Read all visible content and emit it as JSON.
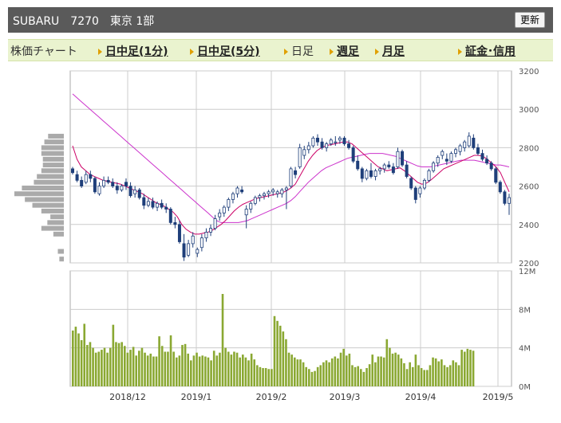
{
  "header": {
    "title": "SUBARU　7270　東京 1部",
    "refresh_label": "更新"
  },
  "tabs": [
    {
      "label": "株価チャート",
      "arrow": false,
      "link": false
    },
    {
      "label": "日中足(1分)",
      "arrow": true,
      "link": true
    },
    {
      "label": "日中足(5分)",
      "arrow": true,
      "link": true
    },
    {
      "label": "日足",
      "arrow": true,
      "link": false
    },
    {
      "label": "週足",
      "arrow": true,
      "link": true
    },
    {
      "label": "月足",
      "arrow": true,
      "link": true
    },
    {
      "label": "証金･信用",
      "arrow": true,
      "link": true
    }
  ],
  "colors": {
    "up_candle": "#ffffff",
    "down_candle": "#1f3f7a",
    "ma_short": "#cc0066",
    "ma_long": "#cc33cc",
    "volume_bar": "#8aa832",
    "grid": "#cccccc"
  },
  "chart_data": [
    {
      "type": "candlestick",
      "y_ticks": [
        2200,
        2400,
        2600,
        2800,
        3000,
        3200
      ],
      "ylim": [
        2200,
        3200
      ],
      "x_tick_labels": [
        "2018/12",
        "2019/1",
        "2019/2",
        "2019/3",
        "2019/4",
        "2019/5"
      ],
      "grid": true,
      "candles": [
        [
          2690,
          2700,
          2660,
          2670
        ],
        [
          2660,
          2680,
          2620,
          2630
        ],
        [
          2630,
          2650,
          2590,
          2600
        ],
        [
          2620,
          2680,
          2610,
          2660
        ],
        [
          2660,
          2680,
          2620,
          2640
        ],
        [
          2640,
          2650,
          2560,
          2570
        ],
        [
          2560,
          2620,
          2550,
          2600
        ],
        [
          2600,
          2650,
          2590,
          2630
        ],
        [
          2630,
          2650,
          2610,
          2620
        ],
        [
          2620,
          2640,
          2590,
          2600
        ],
        [
          2600,
          2620,
          2560,
          2580
        ],
        [
          2580,
          2610,
          2570,
          2600
        ],
        [
          2620,
          2640,
          2580,
          2600
        ],
        [
          2600,
          2620,
          2540,
          2550
        ],
        [
          2560,
          2600,
          2540,
          2580
        ],
        [
          2580,
          2590,
          2530,
          2540
        ],
        [
          2540,
          2560,
          2480,
          2500
        ],
        [
          2500,
          2540,
          2490,
          2520
        ],
        [
          2520,
          2540,
          2480,
          2490
        ],
        [
          2490,
          2520,
          2470,
          2510
        ],
        [
          2510,
          2530,
          2480,
          2490
        ],
        [
          2490,
          2510,
          2460,
          2480
        ],
        [
          2480,
          2490,
          2400,
          2410
        ],
        [
          2410,
          2440,
          2380,
          2400
        ],
        [
          2400,
          2420,
          2300,
          2310
        ],
        [
          2300,
          2350,
          2210,
          2230
        ],
        [
          2240,
          2320,
          2230,
          2300
        ],
        [
          2300,
          2360,
          2280,
          2340
        ],
        [
          2250,
          2280,
          2230,
          2270
        ],
        [
          2280,
          2350,
          2260,
          2330
        ],
        [
          2330,
          2380,
          2310,
          2360
        ],
        [
          2360,
          2400,
          2340,
          2380
        ],
        [
          2380,
          2450,
          2370,
          2430
        ],
        [
          2440,
          2480,
          2420,
          2460
        ],
        [
          2460,
          2500,
          2440,
          2490
        ],
        [
          2490,
          2540,
          2470,
          2530
        ],
        [
          2530,
          2570,
          2510,
          2560
        ],
        [
          2560,
          2600,
          2540,
          2590
        ],
        [
          2580,
          2600,
          2560,
          2570
        ],
        [
          2450,
          2500,
          2380,
          2480
        ],
        [
          2480,
          2520,
          2460,
          2510
        ],
        [
          2510,
          2550,
          2500,
          2540
        ],
        [
          2540,
          2560,
          2520,
          2550
        ],
        [
          2550,
          2570,
          2530,
          2560
        ],
        [
          2560,
          2580,
          2540,
          2570
        ],
        [
          2570,
          2590,
          2550,
          2580
        ],
        [
          2560,
          2580,
          2540,
          2570
        ],
        [
          2560,
          2590,
          2540,
          2580
        ],
        [
          2580,
          2600,
          2480,
          2590
        ],
        [
          2600,
          2700,
          2590,
          2690
        ],
        [
          2680,
          2700,
          2640,
          2660
        ],
        [
          2700,
          2820,
          2690,
          2800
        ],
        [
          2760,
          2810,
          2740,
          2790
        ],
        [
          2790,
          2830,
          2770,
          2810
        ],
        [
          2810,
          2860,
          2800,
          2850
        ],
        [
          2850,
          2870,
          2810,
          2830
        ],
        [
          2830,
          2850,
          2790,
          2800
        ],
        [
          2800,
          2830,
          2780,
          2820
        ],
        [
          2820,
          2850,
          2810,
          2840
        ],
        [
          2830,
          2860,
          2810,
          2830
        ],
        [
          2840,
          2860,
          2820,
          2850
        ],
        [
          2850,
          2860,
          2810,
          2820
        ],
        [
          2820,
          2840,
          2790,
          2800
        ],
        [
          2800,
          2810,
          2720,
          2730
        ],
        [
          2730,
          2760,
          2680,
          2690
        ],
        [
          2690,
          2700,
          2620,
          2640
        ],
        [
          2640,
          2690,
          2630,
          2680
        ],
        [
          2680,
          2720,
          2640,
          2650
        ],
        [
          2650,
          2690,
          2630,
          2680
        ],
        [
          2680,
          2700,
          2660,
          2690
        ],
        [
          2690,
          2720,
          2670,
          2710
        ],
        [
          2710,
          2730,
          2690,
          2700
        ],
        [
          2700,
          2720,
          2660,
          2670
        ],
        [
          2700,
          2800,
          2690,
          2780
        ],
        [
          2780,
          2790,
          2700,
          2710
        ],
        [
          2710,
          2730,
          2640,
          2650
        ],
        [
          2640,
          2650,
          2580,
          2590
        ],
        [
          2590,
          2600,
          2510,
          2530
        ],
        [
          2560,
          2600,
          2540,
          2590
        ],
        [
          2590,
          2640,
          2580,
          2630
        ],
        [
          2630,
          2690,
          2620,
          2680
        ],
        [
          2680,
          2730,
          2670,
          2720
        ],
        [
          2720,
          2760,
          2700,
          2750
        ],
        [
          2760,
          2790,
          2740,
          2780
        ],
        [
          2740,
          2770,
          2710,
          2730
        ],
        [
          2730,
          2780,
          2720,
          2770
        ],
        [
          2770,
          2800,
          2750,
          2790
        ],
        [
          2780,
          2820,
          2760,
          2810
        ],
        [
          2800,
          2840,
          2780,
          2830
        ],
        [
          2810,
          2880,
          2800,
          2860
        ],
        [
          2850,
          2870,
          2790,
          2800
        ],
        [
          2800,
          2820,
          2760,
          2770
        ],
        [
          2770,
          2790,
          2730,
          2740
        ],
        [
          2740,
          2760,
          2710,
          2720
        ],
        [
          2720,
          2730,
          2680,
          2690
        ],
        [
          2690,
          2700,
          2610,
          2620
        ],
        [
          2620,
          2630,
          2560,
          2570
        ],
        [
          2570,
          2580,
          2500,
          2510
        ],
        [
          2510,
          2560,
          2450,
          2540
        ]
      ],
      "ma_short": [
        2810,
        2740,
        2700,
        2680,
        2660,
        2650,
        2640,
        2630,
        2625,
        2620,
        2615,
        2610,
        2600,
        2590,
        2580,
        2570,
        2560,
        2545,
        2530,
        2515,
        2505,
        2495,
        2480,
        2465,
        2440,
        2400,
        2375,
        2360,
        2350,
        2350,
        2355,
        2360,
        2370,
        2385,
        2400,
        2420,
        2445,
        2470,
        2490,
        2505,
        2515,
        2525,
        2535,
        2540,
        2545,
        2550,
        2555,
        2560,
        2565,
        2575,
        2590,
        2610,
        2650,
        2690,
        2730,
        2760,
        2785,
        2800,
        2810,
        2815,
        2820,
        2825,
        2830,
        2830,
        2820,
        2800,
        2780,
        2760,
        2740,
        2720,
        2700,
        2690,
        2680,
        2685,
        2690,
        2695,
        2680,
        2660,
        2640,
        2620,
        2610,
        2615,
        2630,
        2650,
        2670,
        2690,
        2700,
        2710,
        2720,
        2730,
        2740,
        2750,
        2760,
        2760,
        2755,
        2740,
        2720,
        2700,
        2670,
        2620,
        2570
      ],
      "ma_long": [
        3080,
        3060,
        3040,
        3020,
        3000,
        2980,
        2960,
        2940,
        2920,
        2900,
        2880,
        2860,
        2840,
        2820,
        2800,
        2780,
        2760,
        2740,
        2720,
        2700,
        2680,
        2660,
        2640,
        2620,
        2600,
        2580,
        2560,
        2540,
        2520,
        2500,
        2480,
        2460,
        2440,
        2420,
        2410,
        2410,
        2410,
        2410,
        2410,
        2415,
        2420,
        2430,
        2440,
        2450,
        2460,
        2470,
        2480,
        2490,
        2500,
        2510,
        2525,
        2545,
        2570,
        2595,
        2620,
        2640,
        2660,
        2680,
        2695,
        2705,
        2715,
        2725,
        2735,
        2745,
        2750,
        2755,
        2760,
        2765,
        2770,
        2770,
        2770,
        2770,
        2765,
        2760,
        2755,
        2745,
        2735,
        2725,
        2715,
        2705,
        2700,
        2700,
        2700,
        2705,
        2710,
        2715,
        2720,
        2725,
        2730,
        2735,
        2735,
        2735,
        2735,
        2730,
        2725,
        2720,
        2715,
        2710,
        2710,
        2705,
        2700
      ],
      "volume_profile": [
        [
          2860,
          21
        ],
        [
          2830,
          26
        ],
        [
          2800,
          30
        ],
        [
          2770,
          30
        ],
        [
          2740,
          28
        ],
        [
          2710,
          28
        ],
        [
          2680,
          30
        ],
        [
          2650,
          36
        ],
        [
          2620,
          40
        ],
        [
          2590,
          56
        ],
        [
          2560,
          66
        ],
        [
          2530,
          52
        ],
        [
          2500,
          42
        ],
        [
          2470,
          30
        ],
        [
          2440,
          18
        ],
        [
          2410,
          22
        ],
        [
          2380,
          30
        ],
        [
          2350,
          14
        ],
        [
          2260,
          8
        ],
        [
          2220,
          6
        ]
      ]
    },
    {
      "type": "bar",
      "y_ticks": [
        "0M",
        "4M",
        "8M",
        "12M"
      ],
      "ylim": [
        0,
        12
      ],
      "values": [
        5.8,
        6.2,
        5.5,
        4.8,
        6.5,
        4.3,
        4.6,
        4.0,
        3.5,
        3.6,
        3.8,
        4.0,
        3.5,
        4.0,
        6.4,
        4.6,
        4.5,
        4.6,
        4.2,
        3.5,
        3.8,
        4.1,
        3.2,
        3.7,
        4.0,
        3.5,
        3.2,
        3.4,
        3.1,
        3.1,
        5.2,
        4.2,
        3.6,
        3.6,
        5.3,
        3.6,
        3.0,
        3.2,
        4.3,
        4.4,
        3.4,
        2.7,
        3.2,
        3.5,
        3.1,
        3.2,
        3.1,
        3.0,
        2.7,
        3.7,
        3.2,
        3.5,
        9.6,
        4.0,
        3.6,
        3.3,
        3.6,
        3.5,
        3.0,
        3.3,
        3.0,
        2.7,
        3.4,
        2.8,
        2.2,
        2.0,
        1.9,
        1.9,
        1.8,
        1.8,
        7.3,
        6.8,
        6.3,
        5.7,
        4.9,
        3.5,
        3.3,
        3.0,
        2.8,
        2.8,
        2.5,
        2.0,
        1.8,
        1.5,
        1.6,
        2.0,
        2.2,
        2.5,
        2.7,
        2.5,
        2.9,
        3.1,
        2.9,
        3.5,
        3.9,
        3.2,
        3.4,
        2.2,
        2.0,
        2.1,
        1.8,
        1.5,
        1.9,
        2.3,
        3.3,
        2.5,
        3.1,
        3.1,
        3.0,
        4.9,
        4.0,
        3.4,
        3.5,
        3.3,
        2.9,
        2.4,
        1.8,
        2.5,
        2.0,
        3.3,
        2.2,
        1.9,
        1.7,
        1.7,
        2.2,
        3.0,
        2.9,
        2.6,
        2.8,
        2.2,
        2.0,
        2.2,
        2.7,
        2.5,
        2.2,
        3.8,
        3.6,
        3.9,
        3.8,
        3.7
      ]
    }
  ]
}
